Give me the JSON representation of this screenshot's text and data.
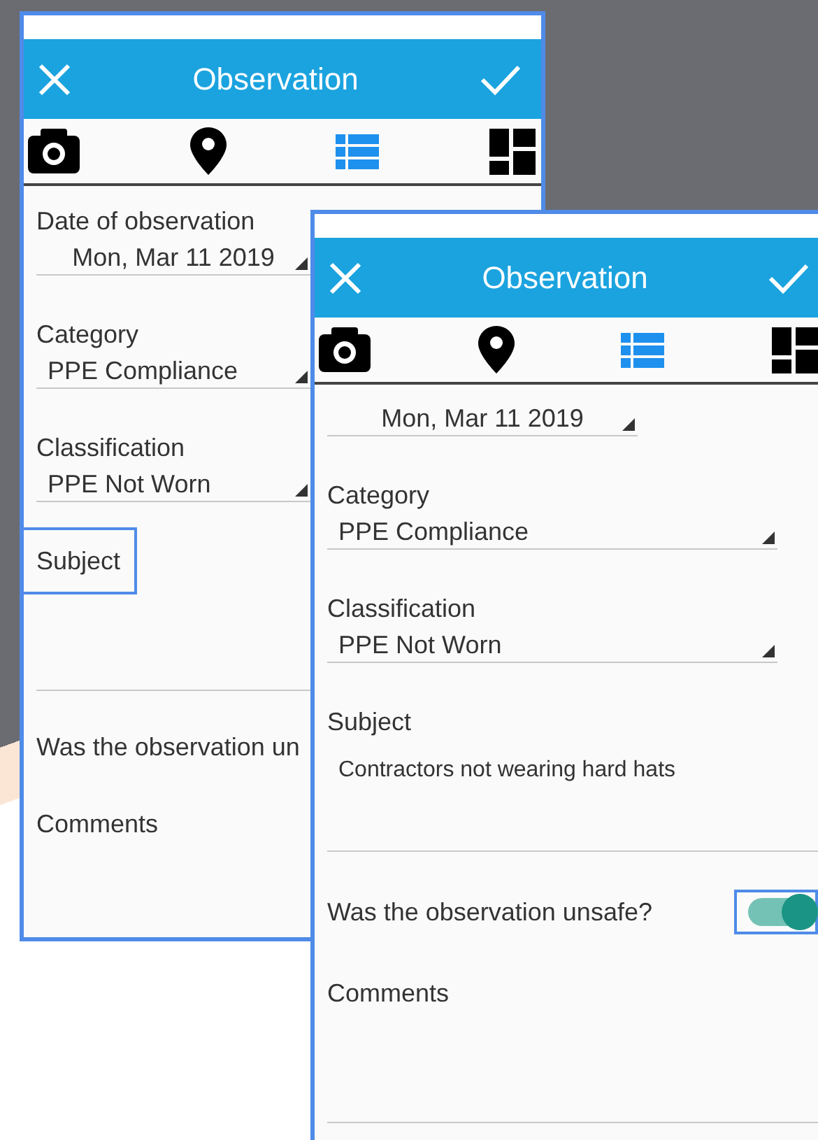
{
  "screens": [
    {
      "title": "Observation",
      "tabs": [
        {
          "selected": false
        },
        {
          "selected": false
        },
        {
          "selected": true
        },
        {
          "selected": false
        }
      ],
      "fields": [
        {
          "kind": "date",
          "label": "Date of observation",
          "value": "Mon, Mar 11 2019"
        },
        {
          "kind": "select",
          "label": "Category",
          "value": "PPE Compliance"
        },
        {
          "kind": "select",
          "label": "Classification",
          "value": "PPE Not Worn"
        },
        {
          "kind": "textarea",
          "label": "Subject",
          "focused": true
        },
        {
          "kind": "toggle",
          "label": "Was the observation un"
        },
        {
          "kind": "textarea",
          "label": "Comments"
        }
      ]
    },
    {
      "title": "Observation",
      "tabs": [
        {
          "selected": false
        },
        {
          "selected": false
        },
        {
          "selected": true
        },
        {
          "selected": false
        }
      ],
      "fields": [
        {
          "kind": "date",
          "value": "Mon, Mar 11 2019"
        },
        {
          "kind": "select",
          "label": "Category",
          "value": "PPE Compliance"
        },
        {
          "kind": "select",
          "label": "Classification",
          "value": "PPE Not Worn"
        },
        {
          "kind": "textarea",
          "label": "Subject",
          "value": "Contractors not wearing hard hats"
        },
        {
          "kind": "toggle",
          "label": "Was the observation unsafe?",
          "on": true,
          "focused": true
        },
        {
          "kind": "textarea",
          "label": "Comments"
        }
      ]
    }
  ]
}
